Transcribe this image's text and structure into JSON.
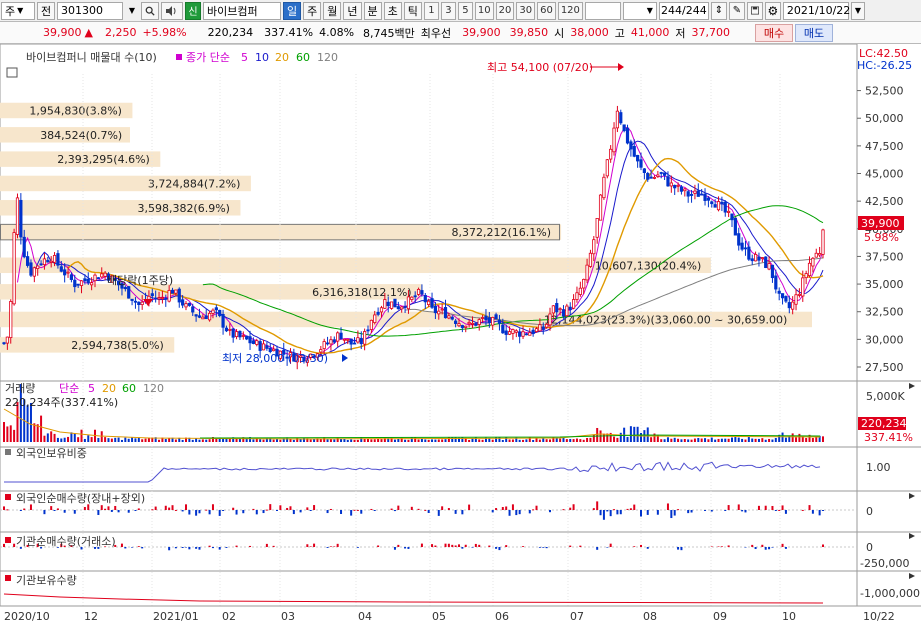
{
  "toolbar": {
    "type_select": "주",
    "market_label": "전",
    "code": "301300",
    "badge": "신",
    "stock_name": "바이브컴퍼",
    "periods": [
      "일",
      "주",
      "월",
      "년",
      "분",
      "초",
      "틱"
    ],
    "active_period": "일",
    "minutes": [
      "1",
      "3",
      "5",
      "10",
      "20",
      "30",
      "60",
      "120"
    ],
    "count": "244",
    "total": "/244",
    "date": "2021/10/22"
  },
  "quote": {
    "price": "39,900",
    "arrow": "▲",
    "change": "2,250",
    "change_pct": "+5.98%",
    "volume": "220,234",
    "volume_ratio": "337.41%",
    "turnover": "4.08%",
    "amount": "8,745백만",
    "ask_label": "최우선",
    "ask": "39,900",
    "bid": "39,850",
    "open_label": "시",
    "open": "38,000",
    "high_label": "고",
    "high": "41,000",
    "low_label": "저",
    "low": "37,700",
    "buy_label": "매수",
    "sell_label": "매도"
  },
  "chart_data": {
    "type": "candlestick",
    "main_panel": {
      "title": "바이브컴퍼니 매물대 수(10)",
      "ma_title": "종가 단순",
      "ma_periods": [
        "5",
        "10",
        "20",
        "60",
        "120"
      ],
      "ma_colors": [
        "#d000d0",
        "#1a1acc",
        "#e09a00",
        "#00a000",
        "#808080"
      ],
      "ylim": [
        27500,
        54000
      ],
      "yticks": [
        "52,500",
        "50,000",
        "47,500",
        "45,000",
        "42,500",
        "40,000",
        "37,500",
        "35,000",
        "32,500",
        "30,000",
        "27,500"
      ],
      "lc_label": "LC:42.50",
      "hc_label": "HC:-26.25",
      "last_price_label": "39,900",
      "last_pct_label": "5.98%",
      "high_annotation": "최고 54,100 (07/20)",
      "low_annotation": "최저 28,000 (03/30)",
      "dividend_label": "배당락(1주당)",
      "volume_profile": [
        {
          "label": "1,954,830(3.8%)",
          "low": 50000,
          "high": 51400
        },
        {
          "label": "384,524(0.7%)",
          "low": 47800,
          "high": 49200
        },
        {
          "label": "2,393,295(4.6%)",
          "low": 45600,
          "high": 47000
        },
        {
          "label": "3,724,884(7.2%)",
          "low": 43400,
          "high": 44800
        },
        {
          "label": "3,598,382(6.9%)",
          "low": 41200,
          "high": 42600
        },
        {
          "label": "8,372,212(16.1%)",
          "low": 39000,
          "high": 40400
        },
        {
          "label": "10,607,130(20.4%)",
          "low": 36000,
          "high": 37400
        },
        {
          "label": "6,316,318(12.1%)",
          "low": 33600,
          "high": 35000
        },
        {
          "label": "12,144,023(23.3%)(33,060.00 ~ 30,659.00)",
          "low": 31100,
          "high": 32500
        },
        {
          "label": "2,594,738(5.0%)",
          "low": 28800,
          "high": 30200
        }
      ]
    },
    "volume_panel": {
      "title": "거래량",
      "ma_title": "단순",
      "ma_periods": [
        "5",
        "20",
        "60",
        "120"
      ],
      "value_label": "220,234주(337.41%)",
      "ytick": "5,000K",
      "last_label": "220,234",
      "last_pct_label": "337.41%"
    },
    "foreign_holding_panel": {
      "title": "외국인보유비중",
      "ytick": "1.00"
    },
    "foreign_net_panel": {
      "title": "외국인순매수량(장내+장외)",
      "ytick": "0"
    },
    "inst_net_panel": {
      "title": "기관순매수량(거래소)",
      "yticks": [
        "0",
        "-250,000"
      ]
    },
    "inst_holding_panel": {
      "title": "기관보유수량",
      "ytick": "-1,000,000"
    },
    "x_labels": [
      "2020/10",
      "12",
      "2021/01",
      "02",
      "03",
      "04",
      "05",
      "06",
      "07",
      "08",
      "09",
      "10",
      "10/22"
    ]
  }
}
